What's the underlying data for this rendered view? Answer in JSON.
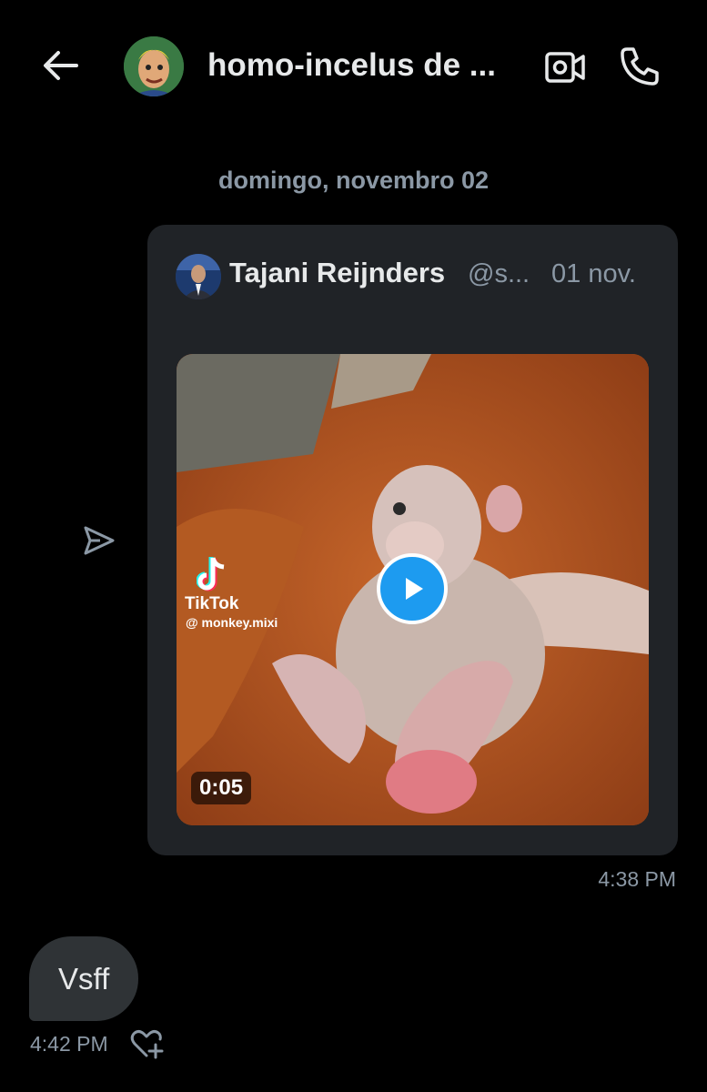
{
  "header": {
    "chat_title": "homo-incelus de ...",
    "back_icon": "arrow-left-icon",
    "video_icon": "video-camera-icon",
    "call_icon": "phone-icon"
  },
  "conversation": {
    "date_separator": "domingo, novembro 02",
    "shared_post": {
      "author_name": "Tajani Reijnders",
      "author_handle": "@s...",
      "date": "01 nov.",
      "video": {
        "duration": "0:05",
        "watermark_label": "TikTok",
        "watermark_user": "@ monkey.mixi"
      }
    },
    "sent_time": "4:38 PM",
    "received_message": {
      "text": "Vsff",
      "time": "4:42 PM"
    }
  },
  "colors": {
    "background": "#000000",
    "card": "#202327",
    "bubble": "#2f3336",
    "accent": "#1d9bf0",
    "muted_text": "#8b98a5"
  }
}
